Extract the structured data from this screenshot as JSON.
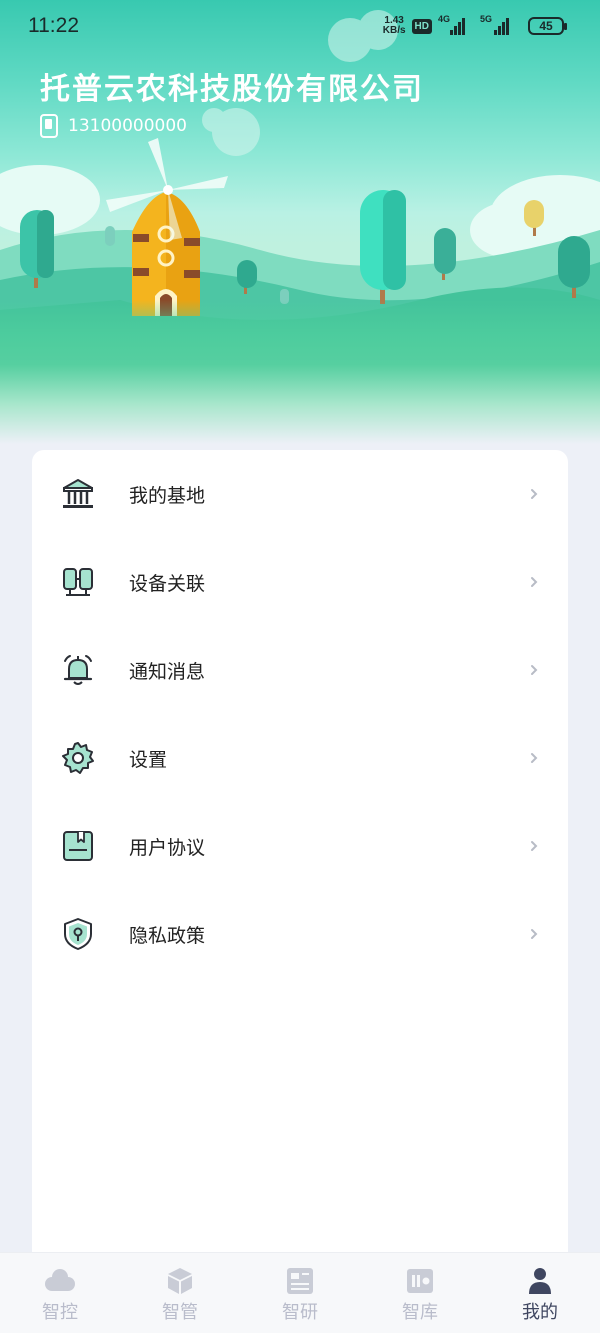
{
  "status_bar": {
    "time": "11:22",
    "net_speed_value": "1.43",
    "net_speed_unit": "KB/s",
    "hd_badge": "HD",
    "signal_1_gen": "4G",
    "signal_2_gen": "5G",
    "battery": "45"
  },
  "profile": {
    "company_name": "托普云农科技股份有限公司",
    "phone": "13100000000"
  },
  "menu": {
    "items": [
      {
        "label": "我的基地",
        "icon": "building-icon"
      },
      {
        "label": "设备关联",
        "icon": "device-link-icon"
      },
      {
        "label": "通知消息",
        "icon": "bell-icon"
      },
      {
        "label": "设置",
        "icon": "gear-icon"
      },
      {
        "label": "用户协议",
        "icon": "document-icon"
      },
      {
        "label": "隐私政策",
        "icon": "shield-icon"
      }
    ]
  },
  "tabs": [
    {
      "label": "智控",
      "icon": "cloud-icon",
      "active": false
    },
    {
      "label": "智管",
      "icon": "cube-icon",
      "active": false
    },
    {
      "label": "智研",
      "icon": "newspaper-icon",
      "active": false
    },
    {
      "label": "智库",
      "icon": "library-icon",
      "active": false
    },
    {
      "label": "我的",
      "icon": "user-icon",
      "active": true
    }
  ],
  "colors": {
    "brand_green": "#3ec8a5",
    "icon_fill": "#a6e3cf",
    "tab_inactive": "#b9bccb",
    "tab_active": "#3f4660"
  }
}
